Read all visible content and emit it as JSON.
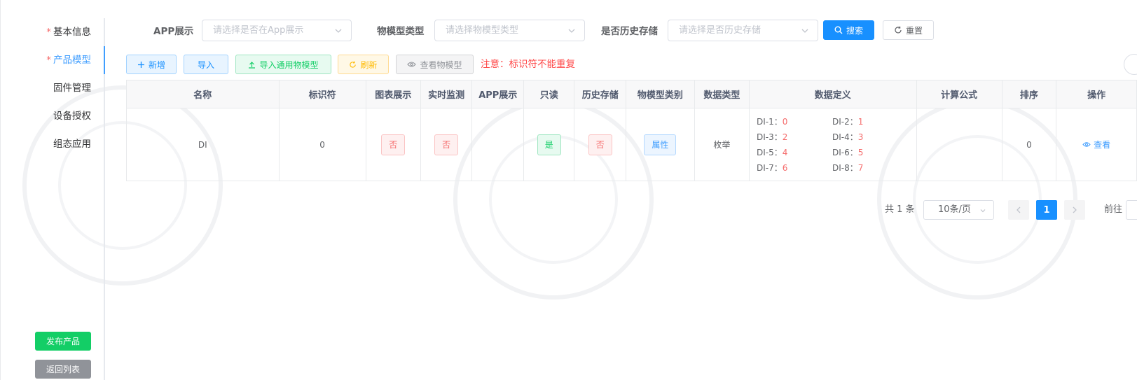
{
  "sidebar": {
    "items": [
      {
        "label": "基本信息",
        "required": true
      },
      {
        "label": "产品模型",
        "required": true,
        "active": true
      },
      {
        "label": "固件管理"
      },
      {
        "label": "设备授权"
      },
      {
        "label": "组态应用"
      }
    ],
    "required_mark": "*",
    "publish_label": "发布产品",
    "back_label": "返回列表"
  },
  "filters": {
    "app_label": "APP展示",
    "app_placeholder": "请选择是否在App展示",
    "type_label": "物模型类型",
    "type_placeholder": "请选择物模型类型",
    "history_label": "是否历史存储",
    "history_placeholder": "请选择是否历史存储",
    "search_label": "搜索",
    "reset_label": "重置"
  },
  "toolbar": {
    "add_label": "新增",
    "import_label": "导入",
    "import_std_label": "导入通用物模型",
    "refresh_label": "刷新",
    "view_label": "查看物模型",
    "notice": "注意：标识符不能重复"
  },
  "table": {
    "headers": [
      "名称",
      "标识符",
      "图表展示",
      "实时监测",
      "APP展示",
      "只读",
      "历史存储",
      "物模型类别",
      "数据类型",
      "数据定义",
      "计算公式",
      "排序",
      "操作"
    ],
    "rows": [
      {
        "name": "DI",
        "identifier": "0",
        "chart": "否",
        "monitor": "否",
        "app": "",
        "readonly": "是",
        "history": "否",
        "category": "属性",
        "datatype": "枚举",
        "definition": [
          {
            "key": "DI-1：",
            "value": "0"
          },
          {
            "key": "DI-2：",
            "value": "1"
          },
          {
            "key": "DI-3：",
            "value": "2"
          },
          {
            "key": "DI-4：",
            "value": "3"
          },
          {
            "key": "DI-5：",
            "value": "4"
          },
          {
            "key": "DI-6：",
            "value": "5"
          },
          {
            "key": "DI-7：",
            "value": "6"
          },
          {
            "key": "DI-8：",
            "value": "7"
          }
        ],
        "formula": "",
        "sort": "0",
        "op_view": "查看"
      }
    ]
  },
  "pagination": {
    "total": "共 1 条",
    "page_size": "10条/页",
    "current": "1",
    "goto_label": "前往"
  },
  "colors": {
    "primary": "#1890ff",
    "success": "#13ce66",
    "warning": "#ffba00",
    "danger": "#f56c6c",
    "info": "#909399"
  }
}
